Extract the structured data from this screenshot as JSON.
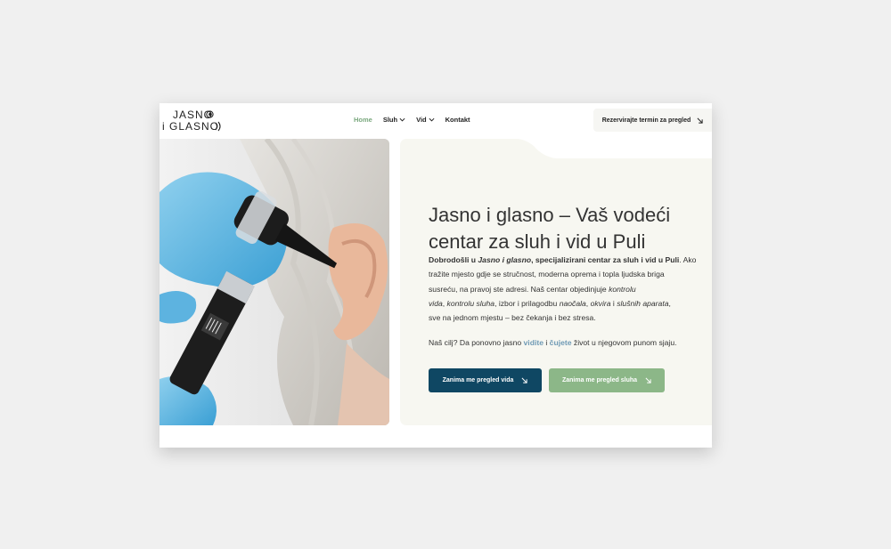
{
  "logo": {
    "line1": "JASNO",
    "line2": "i GLASNO"
  },
  "nav": {
    "items": [
      {
        "label": "Home",
        "active": true,
        "dropdown": false
      },
      {
        "label": "Sluh",
        "active": false,
        "dropdown": true
      },
      {
        "label": "Vid",
        "active": false,
        "dropdown": true
      },
      {
        "label": "Kontakt",
        "active": false,
        "dropdown": false
      }
    ],
    "dropdown_icon": "chevron-down-icon"
  },
  "header_cta": {
    "label": "Rezervirajte termin za pregled",
    "icon": "arrow-down-right-icon"
  },
  "hero": {
    "title_line1": "Jasno i glasno – Vaš vodeći",
    "title_line2": "centar za sluh i vid u Puli",
    "intro": {
      "l1_a": "Dobrodošli u ",
      "l1_b": "Jasno i glasno",
      "l1_c": ", specijalizirani centar za sluh i vid u Puli",
      "l1_d": ". Ako",
      "l2": "tražite mjesto gdje se stručnost, moderna oprema i topla ljudska briga",
      "l3_a": "susreću, na pravoj ste adresi. Naš centar objedinjuje ",
      "l3_b": "kontrolu",
      "l4_a": "vida",
      "l4_b": ", ",
      "l4_c": "kontrolu sluha",
      "l4_d": ", izbor i prilagodbu ",
      "l4_e": "naočala",
      "l4_f": ", ",
      "l4_g": "okvira",
      "l4_h": " i ",
      "l4_i": "slušnih aparata",
      "l4_j": ",",
      "l5": "sve na jednom mjestu – bez čekanja i bez stresa."
    },
    "goal": {
      "a": "Naš cilj? Da ponovno jasno ",
      "b": "vidite",
      "c": " i ",
      "d": "čujete",
      "e": " život u njegovom punom sjaju."
    },
    "buttons": {
      "vid": "Zanima me pregled vida",
      "sluh": "Zanima me pregled sluha",
      "icon": "arrow-down-right-icon"
    }
  },
  "colors": {
    "accent_green": "#7aa87e",
    "button_dark_blue": "#0f4763",
    "button_green": "#8cb788",
    "highlight_blue": "#6f9ab5",
    "content_bg": "#f7f7f1"
  }
}
